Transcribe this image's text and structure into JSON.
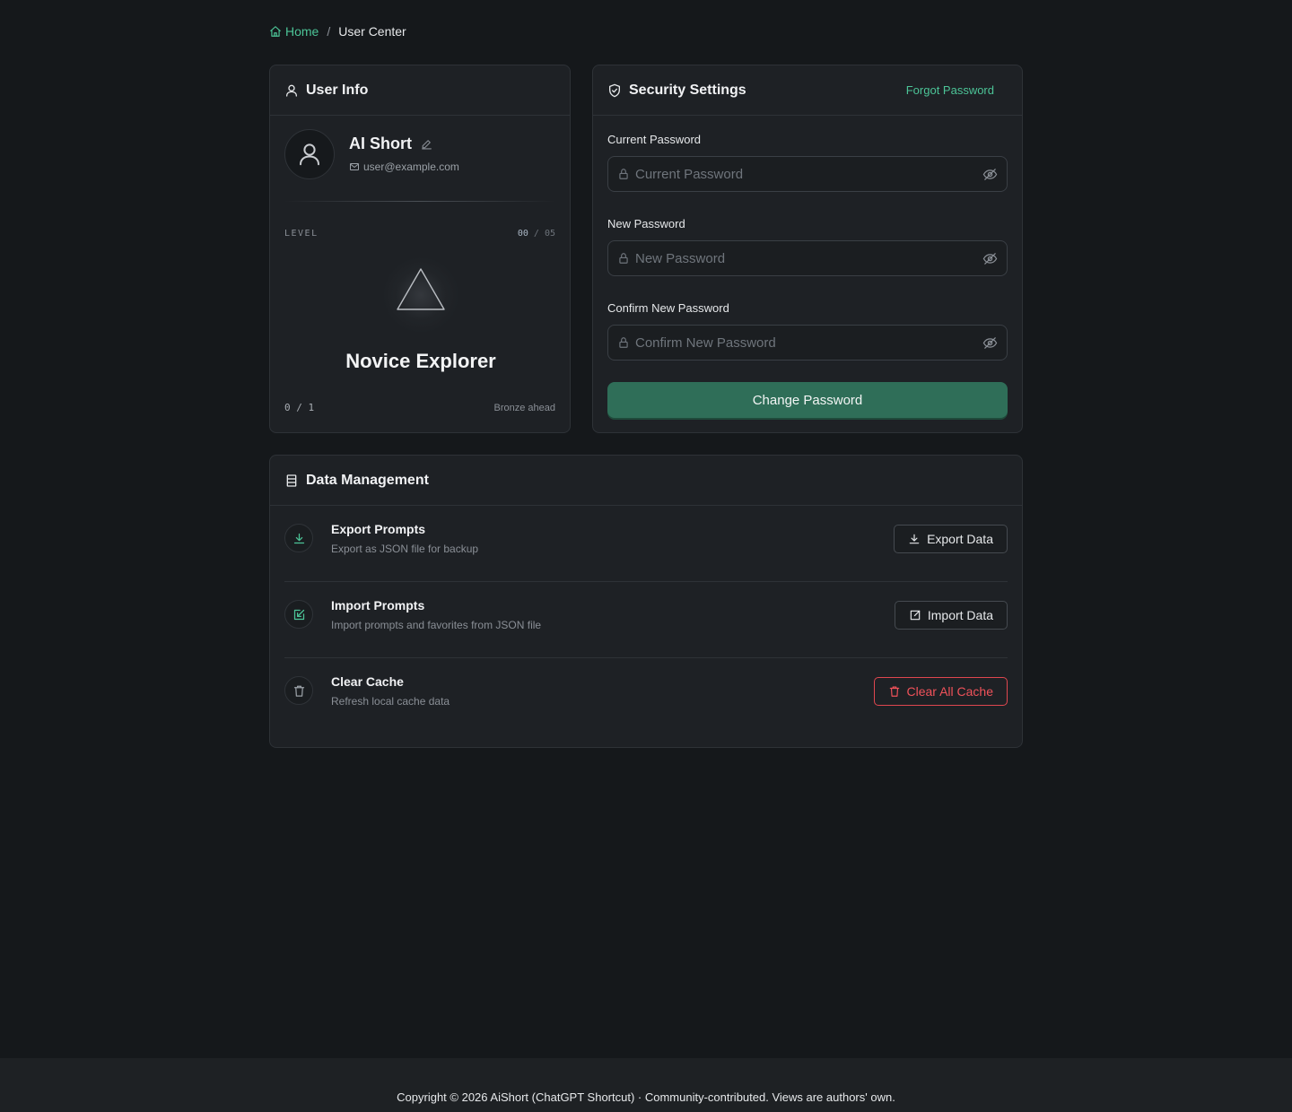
{
  "breadcrumb": {
    "home": "Home",
    "separator": "/",
    "current": "User Center"
  },
  "user_info": {
    "title": "User Info",
    "name": "AI Short",
    "email": "user@example.com",
    "level_label": "LEVEL",
    "level_current": "00",
    "level_separator": " / ",
    "level_max": "05",
    "rank_title": "Novice Explorer",
    "progress": "0 / 1",
    "next_tier": "Bronze ahead"
  },
  "security": {
    "title": "Security Settings",
    "forgot_link": "Forgot Password",
    "fields": [
      {
        "label": "Current Password",
        "placeholder": "Current Password"
      },
      {
        "label": "New Password",
        "placeholder": "New Password"
      },
      {
        "label": "Confirm New Password",
        "placeholder": "Confirm New Password"
      }
    ],
    "submit_label": "Change Password"
  },
  "data_management": {
    "title": "Data Management",
    "rows": [
      {
        "title": "Export Prompts",
        "description": "Export as JSON file for backup",
        "button": "Export Data",
        "icon": "download-icon"
      },
      {
        "title": "Import Prompts",
        "description": "Import prompts and favorites from JSON file",
        "button": "Import Data",
        "icon": "import-icon"
      },
      {
        "title": "Clear Cache",
        "description": "Refresh local cache data",
        "button": "Clear All Cache",
        "icon": "trash-icon"
      }
    ]
  },
  "footer": {
    "text": "Copyright © 2026 AiShort (ChatGPT Shortcut) · Community-contributed. Views are authors' own."
  },
  "colors": {
    "accent": "#4cc497",
    "primary_button": "#2f6e58",
    "danger": "#f0525a",
    "background": "#15181b",
    "card": "#1e2125"
  }
}
